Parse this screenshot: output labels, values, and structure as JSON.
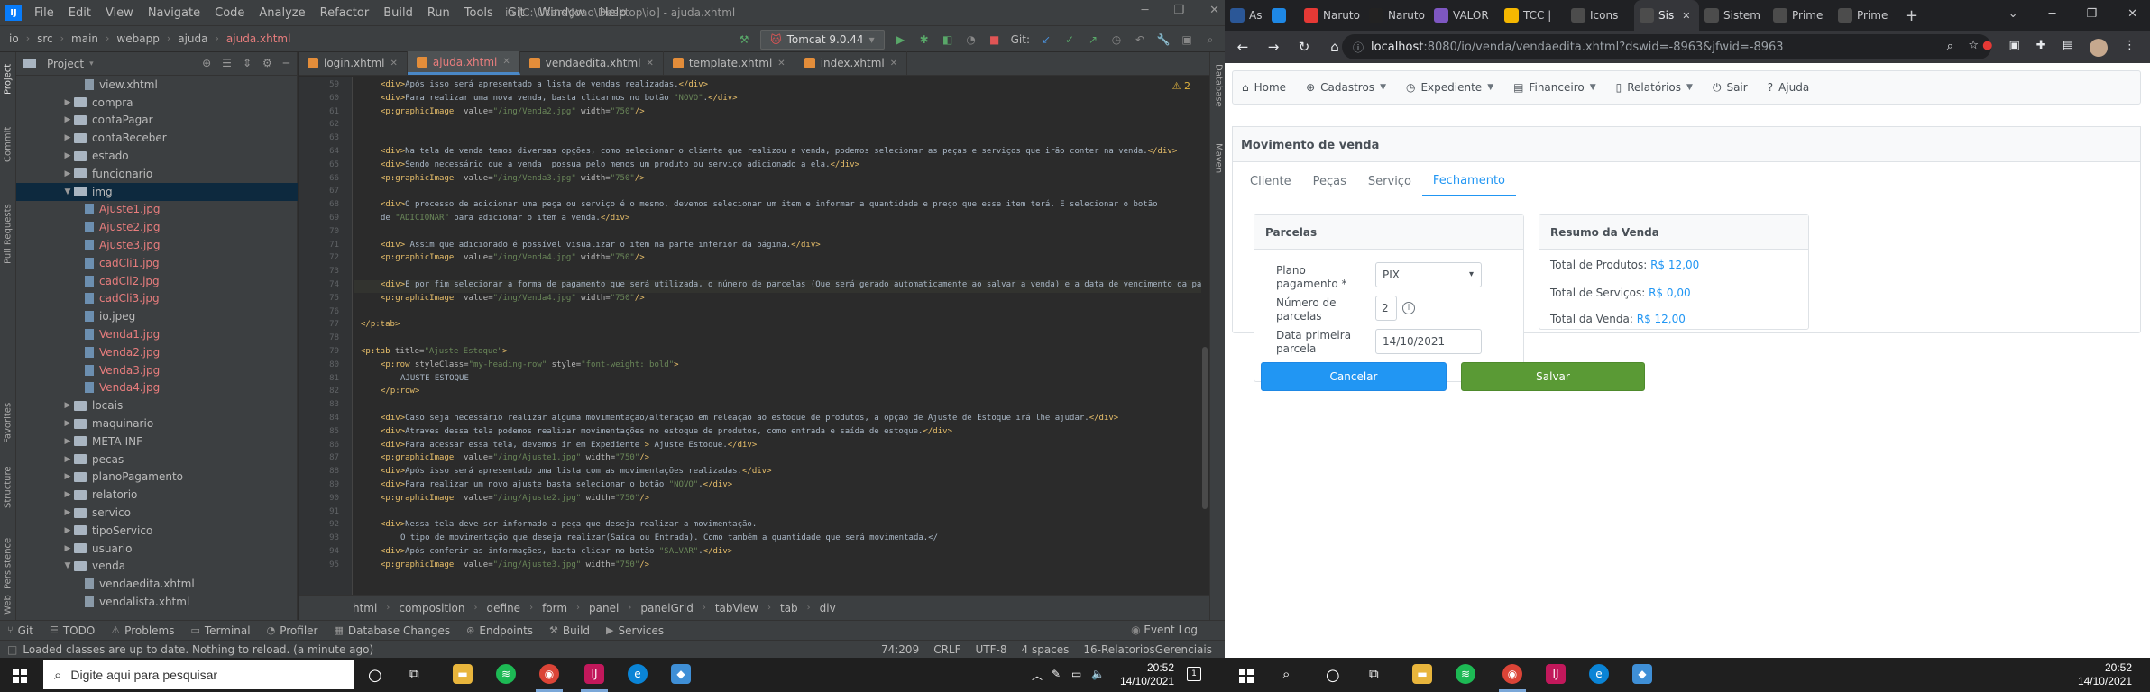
{
  "ide": {
    "menu": [
      "File",
      "Edit",
      "View",
      "Navigate",
      "Code",
      "Analyze",
      "Refactor",
      "Build",
      "Run",
      "Tools",
      "Git",
      "Window",
      "Help"
    ],
    "title": "io [C:\\Users\\Joao\\Desktop\\io] - ajuda.xhtml",
    "breadcrumbs": [
      "io",
      "src",
      "main",
      "webapp",
      "ajuda",
      "ajuda.xhtml"
    ],
    "run_config": "Tomcat 9.0.44",
    "git_label": "Git:",
    "project_title": "Project",
    "tree": [
      {
        "label": "view.xhtml",
        "kind": "file",
        "depth": 5,
        "red": false
      },
      {
        "label": "compra",
        "kind": "folder",
        "depth": 4,
        "red": false
      },
      {
        "label": "contaPagar",
        "kind": "folder",
        "depth": 4,
        "red": false
      },
      {
        "label": "contaReceber",
        "kind": "folder",
        "depth": 4,
        "red": false
      },
      {
        "label": "estado",
        "kind": "folder",
        "depth": 4,
        "red": false
      },
      {
        "label": "funcionario",
        "kind": "folder",
        "depth": 4,
        "red": false
      },
      {
        "label": "img",
        "kind": "folder-open",
        "depth": 4,
        "red": false,
        "selected": true
      },
      {
        "label": "Ajuste1.jpg",
        "kind": "image",
        "depth": 5,
        "red": true
      },
      {
        "label": "Ajuste2.jpg",
        "kind": "image",
        "depth": 5,
        "red": true
      },
      {
        "label": "Ajuste3.jpg",
        "kind": "image",
        "depth": 5,
        "red": true
      },
      {
        "label": "cadCli1.jpg",
        "kind": "image",
        "depth": 5,
        "red": true
      },
      {
        "label": "cadCli2.jpg",
        "kind": "image",
        "depth": 5,
        "red": true
      },
      {
        "label": "cadCli3.jpg",
        "kind": "image",
        "depth": 5,
        "red": true
      },
      {
        "label": "io.jpeg",
        "kind": "image",
        "depth": 5,
        "red": false
      },
      {
        "label": "Venda1.jpg",
        "kind": "image",
        "depth": 5,
        "red": true
      },
      {
        "label": "Venda2.jpg",
        "kind": "image",
        "depth": 5,
        "red": true
      },
      {
        "label": "Venda3.jpg",
        "kind": "image",
        "depth": 5,
        "red": true
      },
      {
        "label": "Venda4.jpg",
        "kind": "image",
        "depth": 5,
        "red": true
      },
      {
        "label": "locais",
        "kind": "folder",
        "depth": 4,
        "red": false
      },
      {
        "label": "maquinario",
        "kind": "folder",
        "depth": 4,
        "red": false
      },
      {
        "label": "META-INF",
        "kind": "folder",
        "depth": 4,
        "red": false
      },
      {
        "label": "pecas",
        "kind": "folder",
        "depth": 4,
        "red": false
      },
      {
        "label": "planoPagamento",
        "kind": "folder",
        "depth": 4,
        "red": false
      },
      {
        "label": "relatorio",
        "kind": "folder",
        "depth": 4,
        "red": false
      },
      {
        "label": "servico",
        "kind": "folder",
        "depth": 4,
        "red": false
      },
      {
        "label": "tipoServico",
        "kind": "folder",
        "depth": 4,
        "red": false
      },
      {
        "label": "usuario",
        "kind": "folder",
        "depth": 4,
        "red": false
      },
      {
        "label": "venda",
        "kind": "folder-open",
        "depth": 4,
        "red": false
      },
      {
        "label": "vendaedita.xhtml",
        "kind": "file",
        "depth": 5,
        "red": false
      },
      {
        "label": "vendalista.xhtml",
        "kind": "file",
        "depth": 5,
        "red": false
      }
    ],
    "editor_tabs": [
      {
        "label": "login.xhtml",
        "active": false
      },
      {
        "label": "ajuda.xhtml",
        "active": true
      },
      {
        "label": "vendaedita.xhtml",
        "active": false
      },
      {
        "label": "template.xhtml",
        "active": false
      },
      {
        "label": "index.xhtml",
        "active": false
      }
    ],
    "warning_count": "2",
    "code_lines": [
      {
        "n": "59",
        "indent": 1,
        "text": "<div>Após isso será apresentado a lista de vendas realizadas.</div>"
      },
      {
        "n": "60",
        "indent": 1,
        "text": "<div>Para realizar uma nova venda, basta clicarmos no botão \"NOVO\".</div>"
      },
      {
        "n": "61",
        "indent": 1,
        "text": "<p:graphicImage  value=\"/img/Venda2.jpg\" width=\"750\"/>"
      },
      {
        "n": "62",
        "indent": 0,
        "text": ""
      },
      {
        "n": "63",
        "indent": 0,
        "text": ""
      },
      {
        "n": "64",
        "indent": 1,
        "text": "<div>Na tela de venda temos diversas opções, como selecionar o cliente que realizou a venda, podemos selecionar as peças e serviços que irão conter na venda.</div>"
      },
      {
        "n": "65",
        "indent": 1,
        "text": "<div>Sendo necessário que a venda  possua pelo menos um produto ou serviço adicionado a ela.</div>"
      },
      {
        "n": "66",
        "indent": 1,
        "text": "<p:graphicImage  value=\"/img/Venda3.jpg\" width=\"750\"/>"
      },
      {
        "n": "67",
        "indent": 0,
        "text": ""
      },
      {
        "n": "68",
        "indent": 1,
        "text": "<div>O processo de adicionar uma peça ou serviço é o mesmo, devemos selecionar um item e informar a quantidade e preço que esse item terá. E selecionar o botão"
      },
      {
        "n": "69",
        "indent": 1,
        "text": "de \"ADICIONAR\" para adicionar o item a venda.</div>"
      },
      {
        "n": "70",
        "indent": 0,
        "text": ""
      },
      {
        "n": "71",
        "indent": 1,
        "text": "<div> Assim que adicionado é possível visualizar o item na parte inferior da página.</div>"
      },
      {
        "n": "72",
        "indent": 1,
        "text": "<p:graphicImage  value=\"/img/Venda4.jpg\" width=\"750\"/>"
      },
      {
        "n": "73",
        "indent": 0,
        "text": ""
      },
      {
        "n": "74",
        "indent": 1,
        "text": "<div>E por fim selecionar a forma de pagamento que será utilizada, o número de parcelas (Que será gerado automaticamente ao salvar a venda) e a data de vencimento da parcela.</div>",
        "hl": true
      },
      {
        "n": "75",
        "indent": 1,
        "text": "<p:graphicImage  value=\"/img/Venda4.jpg\" width=\"750\"/>"
      },
      {
        "n": "76",
        "indent": 0,
        "text": ""
      },
      {
        "n": "77",
        "indent": 0,
        "text": "</p:tab>"
      },
      {
        "n": "78",
        "indent": 0,
        "text": ""
      },
      {
        "n": "79",
        "indent": 0,
        "text": "<p:tab title=\"Ajuste Estoque\">"
      },
      {
        "n": "80",
        "indent": 1,
        "text": "<p:row styleClass=\"my-heading-row\" style=\"font-weight: bold\">"
      },
      {
        "n": "81",
        "indent": 2,
        "text": "AJUSTE ESTOQUE"
      },
      {
        "n": "82",
        "indent": 1,
        "text": "</p:row>"
      },
      {
        "n": "83",
        "indent": 0,
        "text": ""
      },
      {
        "n": "84",
        "indent": 1,
        "text": "<div>Caso seja necessário realizar alguma movimentação/alteração em releação ao estoque de produtos, a opção de Ajuste de Estoque irá lhe ajudar.</div>"
      },
      {
        "n": "85",
        "indent": 1,
        "text": "<div>Atraves dessa tela podemos realizar movimentações no estoque de produtos, como entrada e saída de estoque.</div>"
      },
      {
        "n": "86",
        "indent": 1,
        "text": "<div>Para acessar essa tela, devemos ir em Expediente > Ajuste Estoque.</div>"
      },
      {
        "n": "87",
        "indent": 1,
        "text": "<p:graphicImage  value=\"/img/Ajuste1.jpg\" width=\"750\"/>"
      },
      {
        "n": "88",
        "indent": 1,
        "text": "<div>Após isso será apresentado uma lista com as movimentações realizadas.</div>"
      },
      {
        "n": "89",
        "indent": 1,
        "text": "<div>Para realizar um novo ajuste basta selecionar o botão \"NOVO\".</div>"
      },
      {
        "n": "90",
        "indent": 1,
        "text": "<p:graphicImage  value=\"/img/Ajuste2.jpg\" width=\"750\"/>"
      },
      {
        "n": "91",
        "indent": 0,
        "text": ""
      },
      {
        "n": "92",
        "indent": 1,
        "text": "<div>Nessa tela deve ser informado a peça que deseja realizar a movimentação."
      },
      {
        "n": "93",
        "indent": 2,
        "text": "O tipo de movimentação que deseja realizar(Saída ou Entrada). Como também a quantidade que será movimentada.</"
      },
      {
        "n": "94",
        "indent": 1,
        "text": "<div>Após conferir as informações, basta clicar no botão \"SALVAR\".</div>"
      },
      {
        "n": "95",
        "indent": 1,
        "text": "<p:graphicImage  value=\"/img/Ajuste3.jpg\" width=\"750\"/>"
      }
    ],
    "code_breadcrumbs": [
      "html",
      "composition",
      "define",
      "form",
      "panel",
      "panelGrid",
      "tabView",
      "tab",
      "div"
    ],
    "tool_windows": [
      "Git",
      "TODO",
      "Problems",
      "Terminal",
      "Profiler",
      "Database Changes",
      "Endpoints",
      "Build",
      "Services"
    ],
    "event_log": "Event Log",
    "status_message": "Loaded classes are up to date. Nothing to reload. (a minute ago)",
    "status_right": [
      "74:209",
      "CRLF",
      "UTF-8",
      "4 spaces",
      "16-RelatoriosGerenciais"
    ],
    "left_tool_tabs": [
      "Project",
      "Commit",
      "Pull Requests",
      "Favorites",
      "Structure",
      "Persistence",
      "Web"
    ],
    "right_tool_tabs": [
      "Database",
      "Maven"
    ]
  },
  "browser": {
    "tabs": [
      {
        "label": "As",
        "color": "#2b5797"
      },
      {
        "label": "",
        "color": "#1e88e5"
      },
      {
        "label": "Naruto",
        "color": "#e53935"
      },
      {
        "label": "Naruto",
        "color": "#222222"
      },
      {
        "label": "VALOR",
        "color": "#7e57c2"
      },
      {
        "label": "TCC |",
        "color": "#f5b700"
      },
      {
        "label": "Icons",
        "color": "#4c4c4c"
      },
      {
        "label": "Sis",
        "color": "#4c4c4c",
        "active": true
      },
      {
        "label": "Sistem",
        "color": "#4c4c4c"
      },
      {
        "label": "Prime",
        "color": "#4c4c4c"
      },
      {
        "label": "Prime",
        "color": "#4c4c4c"
      }
    ],
    "url_host": "localhost",
    "url_path": ":8080/io/venda/vendaedita.xhtml?dswid=-8963&jfwid=-8963",
    "app_menu": [
      {
        "label": "Home",
        "icon": "home-icon",
        "caret": false
      },
      {
        "label": "Cadastros",
        "icon": "plus-circle-icon",
        "caret": true
      },
      {
        "label": "Expediente",
        "icon": "clock-icon",
        "caret": true
      },
      {
        "label": "Financeiro",
        "icon": "money-icon",
        "caret": true
      },
      {
        "label": "Relatórios",
        "icon": "file-icon",
        "caret": true
      },
      {
        "label": "Sair",
        "icon": "power-icon",
        "caret": false
      },
      {
        "label": "Ajuda",
        "icon": "question-icon",
        "caret": false
      }
    ],
    "card_title": "Movimento de venda",
    "card_tabs": [
      "Cliente",
      "Peças",
      "Serviço",
      "Fechamento"
    ],
    "parcelas": {
      "title": "Parcelas",
      "plano_label": "Plano pagamento *",
      "plano_value": "PIX",
      "numero_label": "Número de parcelas",
      "numero_value": "2",
      "data_label": "Data primeira parcela",
      "data_value": "14/10/2021"
    },
    "resumo": {
      "title": "Resumo da Venda",
      "produtos_label": "Total de Produtos:",
      "produtos_value": "R$ 12,00",
      "servicos_label": "Total de Serviços:",
      "servicos_value": "R$ 0,00",
      "venda_label": "Total da Venda:",
      "venda_value": "R$ 12,00"
    },
    "cancel_label": "Cancelar",
    "save_label": "Salvar"
  },
  "taskbar": {
    "search_placeholder": "Digite aqui para pesquisar",
    "left_time": "20:52",
    "left_date": "14/10/2021",
    "right_time": "20:52",
    "right_date": "14/10/2021",
    "notif_count": "1"
  },
  "colors": {
    "primary": "#2196f3",
    "success": "#5a9a35",
    "ide_bg": "#2b2b2b",
    "ide_panel": "#3c3f41"
  }
}
